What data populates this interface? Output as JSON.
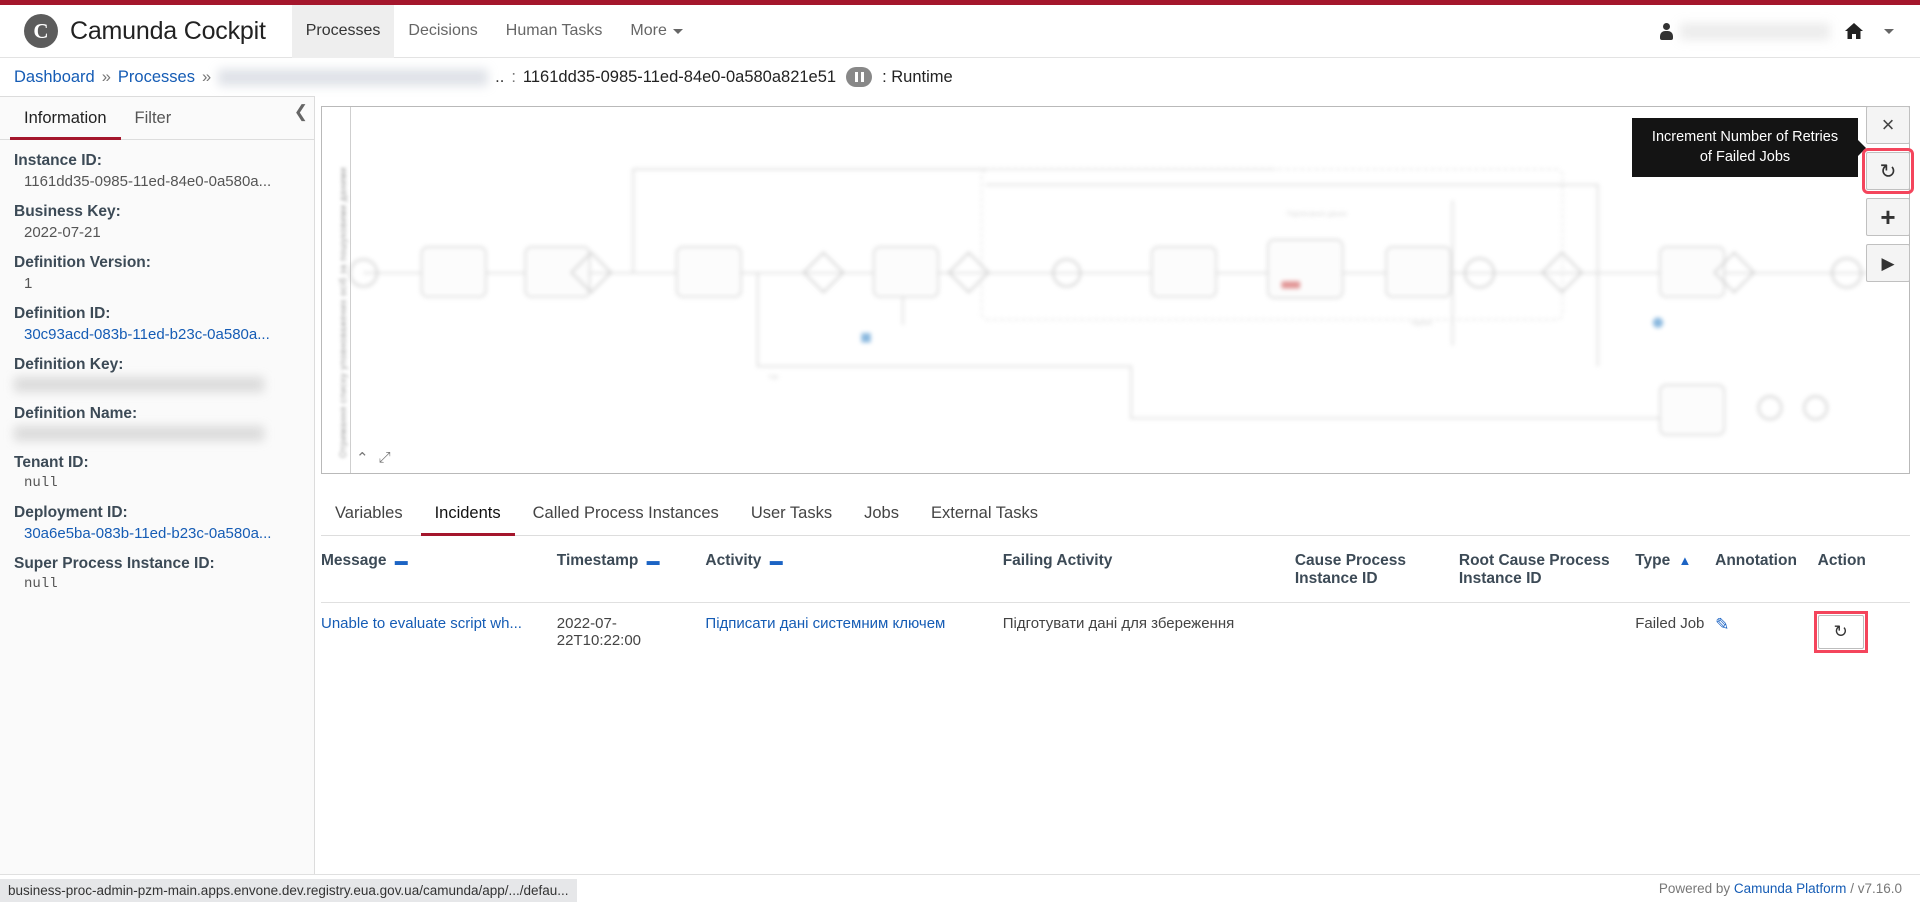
{
  "header": {
    "brand_logo_glyph": "C",
    "brand_title": "Camunda Cockpit",
    "nav": [
      {
        "label": "Processes",
        "active": true
      },
      {
        "label": "Decisions",
        "active": false
      },
      {
        "label": "Human Tasks",
        "active": false
      },
      {
        "label": "More",
        "active": false,
        "has_caret": true
      }
    ],
    "user_name": "",
    "person_icon": "person-icon",
    "home_icon": "home-icon"
  },
  "breadcrumb": {
    "dashboard": "Dashboard",
    "processes": "Processes",
    "separator": "»",
    "process_name": "",
    "truncation": "..",
    "colon": ":",
    "instance_id": "1161dd35-0985-11ed-84e0-0a580a821e51",
    "state_icon": "pause-icon",
    "runtime_label": ": Runtime"
  },
  "sidebar": {
    "collapse_icon": "chevron-left-icon",
    "tabs": [
      {
        "label": "Information",
        "active": true
      },
      {
        "label": "Filter",
        "active": false
      }
    ],
    "properties": [
      {
        "label": "Instance ID:",
        "value": "1161dd35-0985-11ed-84e0-0a580a...",
        "style": "plain"
      },
      {
        "label": "Business Key:",
        "value": "2022-07-21",
        "style": "plain"
      },
      {
        "label": "Definition Version:",
        "value": "1",
        "style": "plain"
      },
      {
        "label": "Definition ID:",
        "value": "30c93acd-083b-11ed-b23c-0a580a...",
        "style": "link"
      },
      {
        "label": "Definition Key:",
        "value": "",
        "style": "blur"
      },
      {
        "label": "Definition Name:",
        "value": "",
        "style": "blur"
      },
      {
        "label": "Tenant ID:",
        "value": "null",
        "style": "mono"
      },
      {
        "label": "Deployment ID:",
        "value": "30a6e5ba-083b-11ed-b23c-0a580a...",
        "style": "link"
      },
      {
        "label": "Super Process Instance ID:",
        "value": "null",
        "style": "mono"
      }
    ]
  },
  "diagram": {
    "vertical_lane_label": "Отримання списку уповноважених осіб за пошуковими даними",
    "collapse_icon": "chevron-up-icon",
    "expand_icon": "expand-diagonal-icon"
  },
  "toolbar": {
    "tooltip_text": "Increment Number of Retries of Failed Jobs",
    "buttons": [
      {
        "name": "cancel-process-instance-button",
        "glyph": "×",
        "highlighted": false
      },
      {
        "name": "increment-retries-button",
        "glyph": "↻",
        "highlighted": true
      },
      {
        "name": "add-variable-button",
        "glyph": "+",
        "highlighted": false
      },
      {
        "name": "suspend-resume-button",
        "glyph": "▶",
        "highlighted": false
      }
    ]
  },
  "lower_tabs": [
    {
      "label": "Variables",
      "active": false
    },
    {
      "label": "Incidents",
      "active": true
    },
    {
      "label": "Called Process Instances",
      "active": false
    },
    {
      "label": "User Tasks",
      "active": false
    },
    {
      "label": "Jobs",
      "active": false
    },
    {
      "label": "External Tasks",
      "active": false
    }
  ],
  "incidents_table": {
    "columns": [
      {
        "label": "Message",
        "sort": "dash"
      },
      {
        "label": "Timestamp",
        "sort": "dash"
      },
      {
        "label": "Activity",
        "sort": "dash"
      },
      {
        "label": "Failing Activity",
        "sort": ""
      },
      {
        "label": "Cause Process Instance ID",
        "sort": ""
      },
      {
        "label": "Root Cause Process Instance ID",
        "sort": ""
      },
      {
        "label": "Type",
        "sort": "up"
      },
      {
        "label": "Annotation",
        "sort": ""
      },
      {
        "label": "Action",
        "sort": ""
      }
    ],
    "rows": [
      {
        "message": "Unable to evaluate script wh...",
        "timestamp": "2022-07-22T10:22:00",
        "activity": "Підписати дані системним ключем",
        "failing_activity": "Підготувати дані для збереження",
        "cause_process_instance_id": "",
        "root_cause_process_instance_id": "",
        "type": "Failed Job",
        "annotation_icon": "pencil-icon",
        "action_icon": "retry-icon"
      }
    ]
  },
  "status_bar": {
    "url": "business-proc-admin-pzm-main.apps.envone.dev.registry.eua.gov.ua/camunda/app/.../defau..."
  },
  "footer": {
    "powered_by": "Powered by",
    "platform_link": "Camunda Platform",
    "version": "/ v7.16.0"
  },
  "colors": {
    "brand_red": "#a4162c",
    "link_blue": "#155cb5",
    "highlight_red": "#f4455c",
    "tooltip_bg": "#141414"
  }
}
